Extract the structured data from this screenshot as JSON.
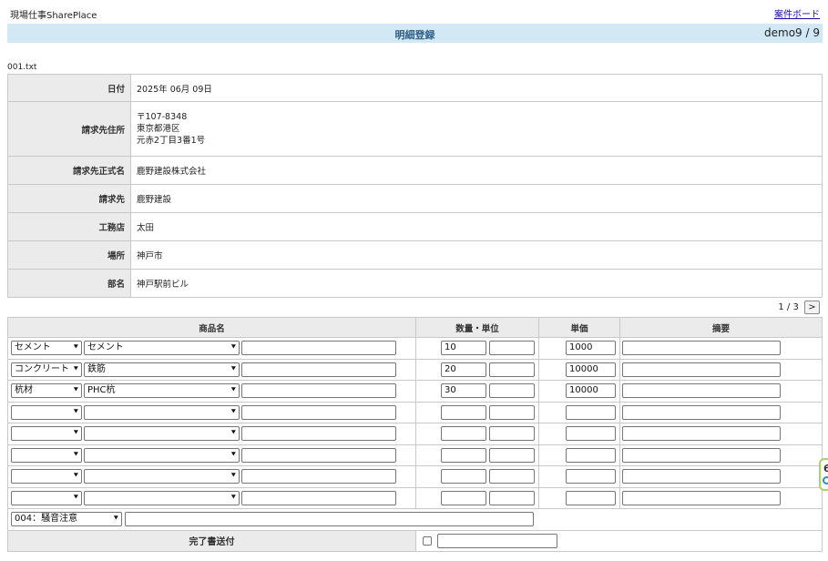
{
  "header": {
    "app_title": "現場仕事SharePlace",
    "board_link": "案件ボード",
    "page_title": "明細登録",
    "user_info": "demo9 / 9"
  },
  "filename": "001.txt",
  "info": {
    "date_label": "日付",
    "date_value": "2025年 06月 09日",
    "address_label": "請求先住所",
    "address_lines": [
      "〒107-8348",
      "東京都港区",
      "元赤2丁目3番1号"
    ],
    "official_name_label": "請求先正式名",
    "official_name_value": "鹿野建設株式会社",
    "billing_label": "請求先",
    "billing_value": "鹿野建設",
    "contractor_label": "工務店",
    "contractor_value": "太田",
    "location_label": "場所",
    "location_value": "神戸市",
    "department_label": "部名",
    "department_value": "神戸駅前ビル"
  },
  "pager": {
    "label": "1 / 3",
    "next_label": ">"
  },
  "items": {
    "headers": {
      "name": "商品名",
      "qty_unit": "数量・単位",
      "price": "単価",
      "memo": "摘要"
    },
    "rows": [
      {
        "category": "セメント",
        "product": "セメント",
        "free": "",
        "qty": "10",
        "unit": "",
        "price": "1000",
        "memo": ""
      },
      {
        "category": "コンクリート",
        "product": "鉄筋",
        "free": "",
        "qty": "20",
        "unit": "",
        "price": "10000",
        "memo": ""
      },
      {
        "category": "杭材",
        "product": "PHC杭",
        "free": "",
        "qty": "30",
        "unit": "",
        "price": "10000",
        "memo": ""
      },
      {
        "category": "",
        "product": "",
        "free": "",
        "qty": "",
        "unit": "",
        "price": "",
        "memo": ""
      },
      {
        "category": "",
        "product": "",
        "free": "",
        "qty": "",
        "unit": "",
        "price": "",
        "memo": ""
      },
      {
        "category": "",
        "product": "",
        "free": "",
        "qty": "",
        "unit": "",
        "price": "",
        "memo": ""
      },
      {
        "category": "",
        "product": "",
        "free": "",
        "qty": "",
        "unit": "",
        "price": "",
        "memo": ""
      },
      {
        "category": "",
        "product": "",
        "free": "",
        "qty": "",
        "unit": "",
        "price": "",
        "memo": ""
      }
    ],
    "note_select": "004：騒音注意",
    "note_text": "",
    "complete_label": "完了書送付",
    "complete_text": ""
  },
  "icons": {
    "dropdown": "chevron-down-icon",
    "side_widget": "feedback-widget-icon"
  },
  "colors": {
    "title_bar_bg": "#d3e8f5",
    "title_text": "#2e5f86",
    "label_bg": "#ebebeb",
    "link": "#1a0dab"
  }
}
